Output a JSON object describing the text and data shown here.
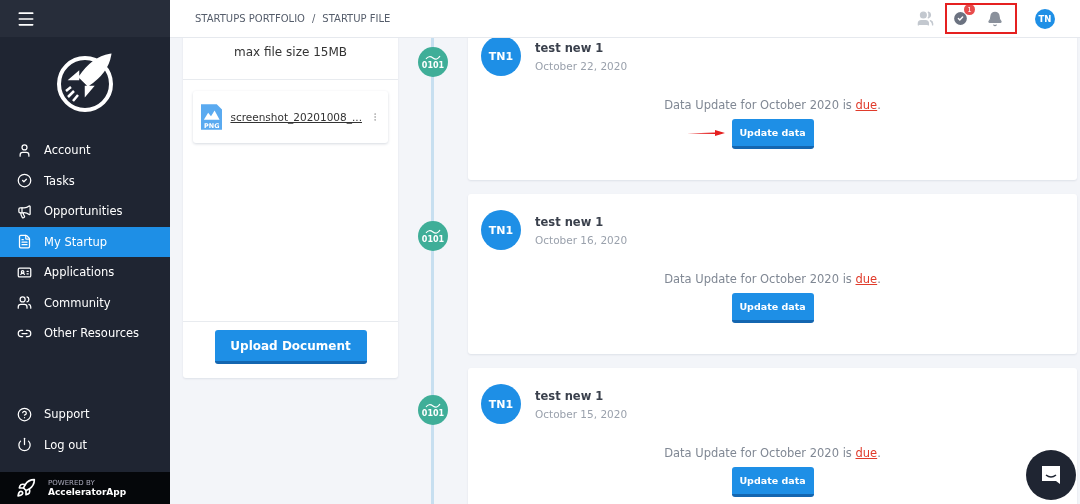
{
  "sidebar": {
    "items": [
      {
        "label": "Account",
        "selected": false
      },
      {
        "label": "Tasks",
        "selected": false
      },
      {
        "label": "Opportunities",
        "selected": false
      },
      {
        "label": "My Startup",
        "selected": true
      },
      {
        "label": "Applications",
        "selected": false
      },
      {
        "label": "Community",
        "selected": false
      },
      {
        "label": "Other Resources",
        "selected": false
      }
    ],
    "bottom_items": [
      {
        "label": "Support"
      },
      {
        "label": "Log out"
      }
    ],
    "powered_by": {
      "caption": "POWERED BY",
      "brand": "AcceleratorApp"
    }
  },
  "header": {
    "breadcrumb": [
      "STARTUPS PORTFOLIO",
      "STARTUP FILE"
    ],
    "separator": "/",
    "task_badge": "1",
    "user_initials": "TN"
  },
  "documents": {
    "note": "max file size 15MB",
    "files": [
      {
        "name": "screenshot_20201008_...",
        "type": "PNG"
      }
    ],
    "upload_button": "Upload Document"
  },
  "feed": [
    {
      "avatar": "TN1",
      "name": "test new 1",
      "date": "October 22, 2020",
      "node": "0101",
      "message": "Data Update for October 2020 is **due**.",
      "button": "Update data",
      "arrow": true
    },
    {
      "avatar": "TN1",
      "name": "test new 1",
      "date": "October 16, 2020",
      "node": "0101",
      "message": "Data Update for October 2020 is **due**.",
      "button": "Update data",
      "arrow": false
    },
    {
      "avatar": "TN1",
      "name": "test new 1",
      "date": "October 15, 2020",
      "node": "0101",
      "message": "Data Update for October 2020 is **due**.",
      "button": "Update data",
      "arrow": false
    }
  ]
}
